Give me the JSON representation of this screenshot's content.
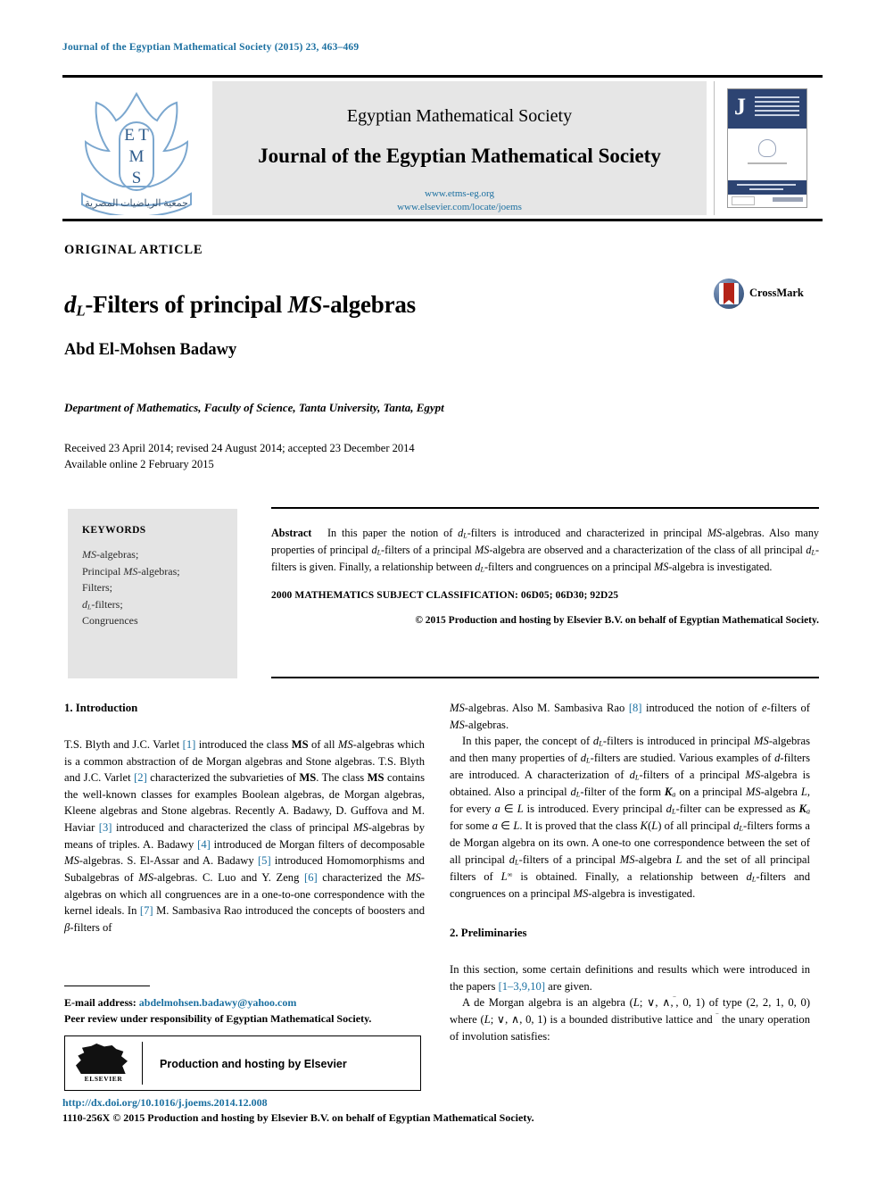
{
  "running_head": "Journal of the Egyptian Mathematical Society (2015) 23, 463–469",
  "masthead": {
    "logo_letters": [
      "E",
      "T",
      "M",
      "S"
    ],
    "logo_caption_arabic": "جمعية الرياضيات المصرية",
    "society": "Egyptian Mathematical Society",
    "journal": "Journal of the Egyptian Mathematical Society",
    "url_society": "www.etms-eg.org",
    "url_elsevier": "www.elsevier.com/locate/joems",
    "cover_letter": "J"
  },
  "article": {
    "kind": "ORIGINAL ARTICLE",
    "title_prefix": "d",
    "title_sub": "L",
    "title_mid": "-Filters of principal ",
    "title_italic": "MS",
    "title_suffix": "-algebras",
    "crossmark_label": "CrossMark",
    "author": "Abd El-Mohsen Badawy",
    "affiliation": "Department of Mathematics, Faculty of Science, Tanta University, Tanta, Egypt",
    "received": "Received 23 April 2014; revised 24 August 2014; accepted 23 December 2014",
    "available": "Available online 2 February 2015"
  },
  "keywords": {
    "heading": "KEYWORDS",
    "items": [
      "MS-algebras;",
      "Principal MS-algebras;",
      "Filters;",
      "dL-filters;",
      "Congruences"
    ]
  },
  "abstract": {
    "label": "Abstract",
    "text": "In this paper the notion of dL-filters is introduced and characterized in principal MS-algebras. Also many properties of principal dL-filters of a principal MS-algebra are observed and a characterization of the class of all principal dL-filters is given. Finally, a relationship between dL-filters and congruences on a principal MS-algebra is investigated.",
    "msc": "2000 MATHEMATICS SUBJECT CLASSIFICATION:   06D05; 06D30; 92D25",
    "copyright": "© 2015 Production and hosting by Elsevier B.V. on behalf of Egyptian Mathematical Society."
  },
  "sections": {
    "introduction_heading": "1. Introduction",
    "preliminaries_heading": "2. Preliminaries",
    "intro_p1": "T.S. Blyth and J.C. Varlet [1] introduced the class MS of all MS-algebras which is a common abstraction of de Morgan algebras and Stone algebras. T.S. Blyth and J.C. Varlet [2] characterized the subvarieties of MS. The class MS contains the well-known classes for examples Boolean algebras, de Morgan algebras, Kleene algebras and Stone algebras. Recently A. Badawy, D. Guffova and M. Haviar [3] introduced and characterized the class of principal MS-algebras by means of triples. A. Badawy [4] introduced de Morgan filters of decomposable MS-algebras. S. El-Assar and A. Badawy [5] introduced Homomorphisms and Subalgebras of MS-algebras. C. Luo and Y. Zeng [6] characterized the MS-algebras on which all congruences are in a one-to-one correspondence with the kernel ideals. In [7] M. Sambasiva Rao introduced the concepts of boosters and β-filters of MS-algebras. Also M. Sambasiva Rao [8] introduced the notion of e-filters of MS-algebras.",
    "intro_p2": "In this paper, the concept of dL-filters is introduced in principal MS-algebras and then many properties of dL-filters are studied. Various examples of d-filters are introduced. A characterization of dL-filters of a principal MS-algebra is obtained. Also a principal dL-filter of the form Ka on a principal MS-algebra L, for every a ∈ L is introduced. Every principal dL-filter can be expressed as Ka for some a ∈ L. It is proved that the class K(L) of all principal dL-filters forms a de Morgan algebra on its own. A one-to one correspondence between the set of all principal dL-filters of a principal MS-algebra L and the set of all principal filters of L∞ is obtained. Finally, a relationship between dL-filters and congruences on a principal MS-algebra is investigated.",
    "prelim_p1": "In this section, some certain definitions and results which were introduced in the papers [1–3,9,10] are given.",
    "prelim_p2": "A de Morgan algebra is an algebra (L; ∨, ∧,⁻, 0, 1) of type (2, 2, 1, 0, 0) where (L; ∨, ∧, 0, 1) is a bounded distributive lattice and ⁻ the unary operation of involution satisfies:"
  },
  "footnotes": {
    "email_label": "E-mail address:",
    "email": "abdelmohsen.badawy@yahoo.com",
    "peer_review": "Peer review under responsibility of Egyptian Mathematical Society.",
    "elsevier_word": "ELSEVIER",
    "production_hosting": "Production and hosting by Elsevier"
  },
  "page_footer": {
    "doi": "http://dx.doi.org/10.1016/j.joems.2014.12.008",
    "issn_line": "1110-256X © 2015 Production and hosting by Elsevier B.V. on behalf of Egyptian Mathematical Society."
  },
  "colors": {
    "link": "#1a6fa0",
    "keyword_box": "#e4e4e4",
    "masthead_panel": "#e6e6e6",
    "cover_navy": "#2d4472"
  }
}
